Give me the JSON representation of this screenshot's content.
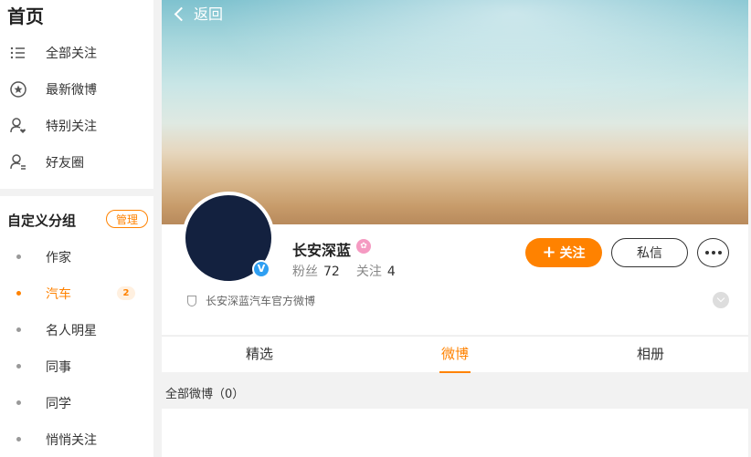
{
  "sidebar": {
    "home": "首页",
    "nav": [
      {
        "label": "全部关注",
        "icon": "list-icon"
      },
      {
        "label": "最新微博",
        "icon": "star-circle-icon"
      },
      {
        "label": "特别关注",
        "icon": "user-heart-icon"
      },
      {
        "label": "好友圈",
        "icon": "user-friends-icon"
      }
    ],
    "group_title": "自定义分组",
    "manage_label": "管理",
    "groups": [
      {
        "label": "作家"
      },
      {
        "label": "汽车",
        "badge": "2",
        "active": true
      },
      {
        "label": "名人明星"
      },
      {
        "label": "同事"
      },
      {
        "label": "同学"
      },
      {
        "label": "悄悄关注"
      }
    ]
  },
  "header": {
    "back_label": "返回"
  },
  "profile": {
    "name": "长安深蓝",
    "fans_label": "粉丝",
    "fans_count": "72",
    "following_label": "关注",
    "following_count": "4",
    "verified_glyph": "V",
    "description": "长安深蓝汽车官方微博",
    "follow_label": "关注",
    "message_label": "私信"
  },
  "tabs": [
    {
      "label": "精选"
    },
    {
      "label": "微博",
      "active": true
    },
    {
      "label": "相册"
    }
  ],
  "feed": {
    "section_title": "全部微博（0）"
  },
  "colors": {
    "accent": "#ff8200",
    "avatar": "#13213f",
    "verified": "#2f9ff2"
  }
}
